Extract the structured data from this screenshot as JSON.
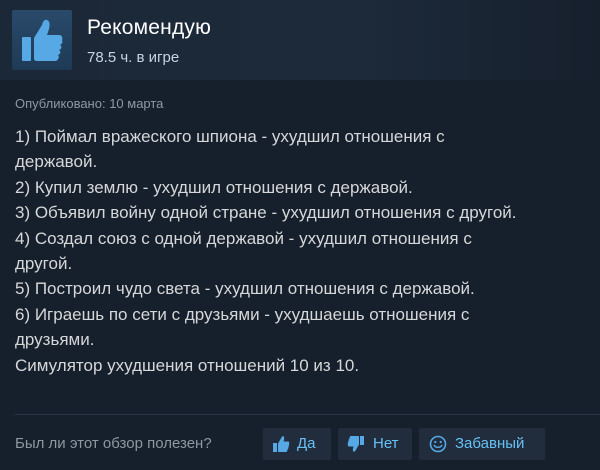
{
  "review": {
    "verdict": "Рекомендую",
    "verdict_icon": "thumbs-up-icon",
    "playtime": "78.5 ч. в игре",
    "posted": "Опубликовано: 10 марта",
    "lines": [
      "1) Поймал вражеского шпиона - ухудшил отношения с",
      "державой.",
      "2) Купил землю - ухудшил отношения с державой.",
      "3) Объявил войну одной стране - ухудшил отношения с другой.",
      "4) Создал союз с одной державой - ухудшил отношения с",
      "другой.",
      "5) Построил чудо света - ухудшил отношения с державой.",
      "6) Играешь по сети с друзьями - ухудшаешь отношения с",
      "друзьями.",
      "Симулятор ухудшения отношений 10 из 10."
    ]
  },
  "feedback": {
    "question": "Был ли этот обзор полезен?",
    "yes_label": "Да",
    "no_label": "Нет",
    "funny_label": "Забавный",
    "yes_icon": "thumbs-up-icon",
    "no_icon": "thumbs-down-icon",
    "funny_icon": "smiley-icon"
  },
  "colors": {
    "background": "#16202d",
    "accent": "#67c1f5",
    "icon_blue": "#57a9e6",
    "button_bg": "#212c3d"
  }
}
